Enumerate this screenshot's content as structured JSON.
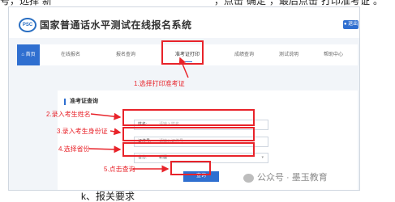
{
  "top_text": {
    "part1": "号，选择“新",
    "part2": "”，点击“确定”，最后点击“打印准考证”。"
  },
  "header": {
    "logo_text": "PSC",
    "title": "国家普通话水平测试在线报名系统",
    "exit_label": "退出"
  },
  "nav": {
    "items": [
      {
        "label": "首页"
      },
      {
        "label": "在线报名"
      },
      {
        "label": "报名查询"
      },
      {
        "label": "准考证打印"
      },
      {
        "label": "成绩查询"
      },
      {
        "label": "测试说明"
      },
      {
        "label": "帮助中心"
      }
    ],
    "active_index": 3
  },
  "panel": {
    "section_title": "准考证查询",
    "name_label": "姓名:",
    "name_placeholder": "请输入姓名",
    "id_label": "证件号:",
    "id_placeholder": "请输入证件号",
    "province_label": "省份:",
    "province_value": "新疆",
    "query_button": "查询"
  },
  "annotations": {
    "step1": "1.选择打印准考证",
    "step2": "2.录入考生姓名",
    "step3": "3.录入考生身份证",
    "step4": "4.选择省份",
    "step5": "5.点击查询"
  },
  "watermark": "公众号 · 墨玉教育",
  "bottom_text": "k、报关要求",
  "colors": {
    "accent": "#2f6fd0",
    "annotation": "#e8232a"
  }
}
